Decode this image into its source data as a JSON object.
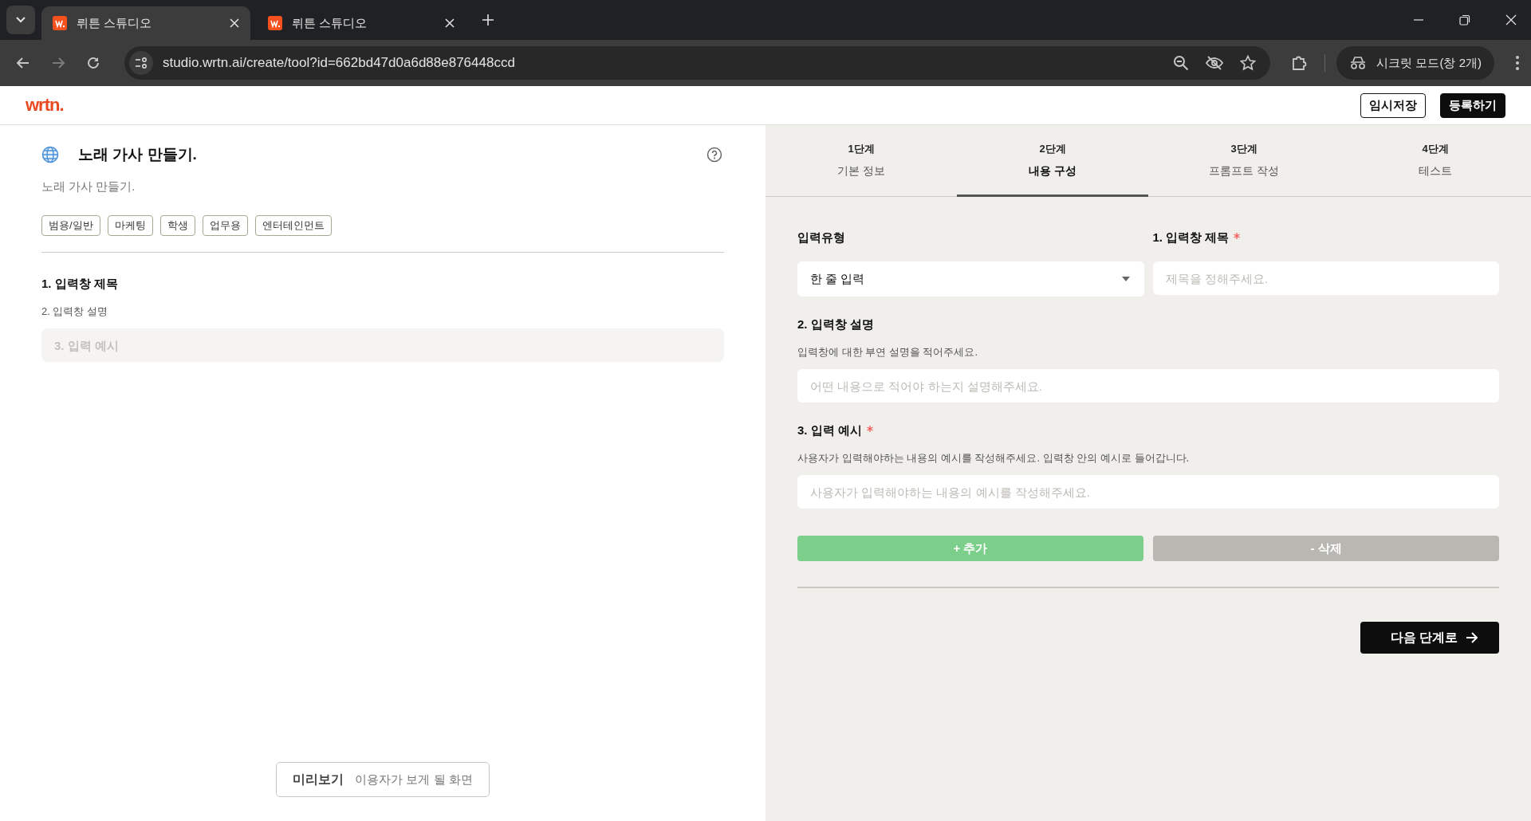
{
  "browser": {
    "tabs": [
      {
        "title": "뤼튼 스튜디오",
        "selected": true
      },
      {
        "title": "뤼튼 스튜디오",
        "selected": false
      }
    ],
    "url": "studio.wrtn.ai/create/tool?id=662bd47d0a6d88e876448ccd",
    "profile": "시크릿 모드(창 2개)"
  },
  "header": {
    "logo": "wrtn.",
    "buttons": [
      {
        "label": "임시저장",
        "kind": "outline"
      },
      {
        "label": "등록하기",
        "kind": "solid"
      }
    ]
  },
  "tool": {
    "title": "노래 가사 만들기.",
    "description": "노래 가사 만들기.",
    "tags": [
      "범용/일반",
      "마케팅",
      "학생",
      "업무용",
      "엔터테인먼트"
    ]
  },
  "preview": {
    "field_title": "1. 입력창 제목",
    "field_description": "2. 입력창 설명",
    "field_placeholder": "3. 입력 예시"
  },
  "preview_button": {
    "label": "미리보기",
    "caption": "이용자가 보게 될 화면"
  },
  "steps": [
    {
      "step": "1단계",
      "label": "기본 정보",
      "selected": false
    },
    {
      "step": "2단계",
      "label": "내용 구성",
      "selected": true
    },
    {
      "step": "3단계",
      "label": "프롬프트 작성",
      "selected": false
    },
    {
      "step": "4단계",
      "label": "테스트",
      "selected": false
    }
  ],
  "form": {
    "input_type": {
      "label": "입력유형",
      "value": "한 줄 입력"
    },
    "title_field": {
      "label": "1. 입력창 제목",
      "required": true,
      "placeholder": "제목을 정해주세요."
    },
    "description_field": {
      "label": "2. 입력창 설명",
      "help": "입력창에 대한 부연 설명을 적어주세요.",
      "placeholder": "어떤 내용으로 적어야 하는지 설명해주세요."
    },
    "example_field": {
      "label": "3. 입력 예시",
      "required": true,
      "help": "사용자가 입력해야하는 내용의 예시를 작성해주세요. 입력창 안의 예시로 들어갑니다.",
      "placeholder": "사용자가 입력해야하는 내용의 예시를 작성해주세요."
    },
    "actions": [
      {
        "label": "+ 추가",
        "kind": "add",
        "disabled": false
      },
      {
        "label": "- 삭제",
        "kind": "remove",
        "disabled": true
      }
    ]
  },
  "next_button": {
    "label": "다음 단계로"
  }
}
